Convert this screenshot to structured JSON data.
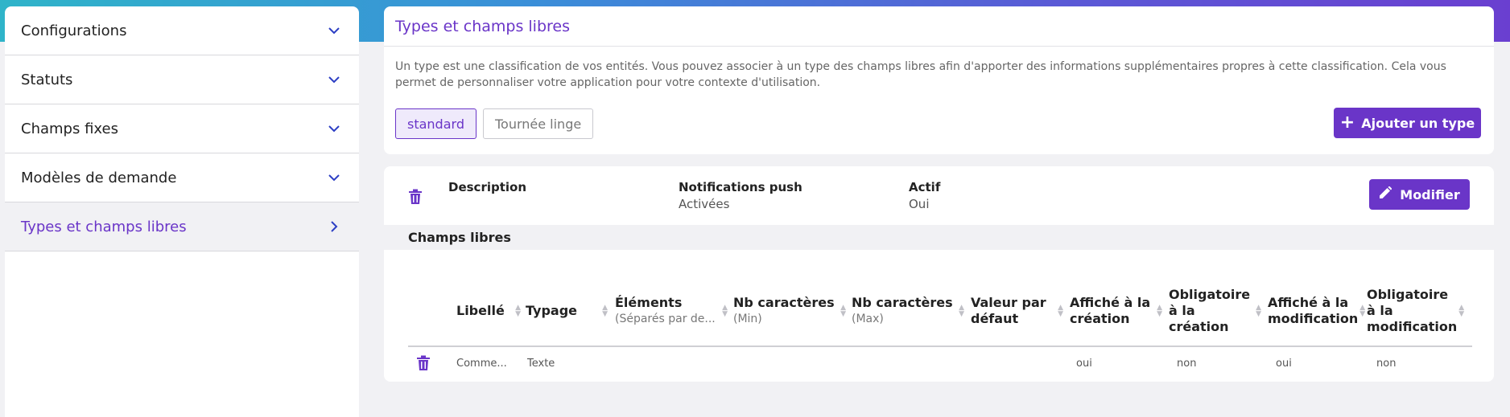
{
  "sidebar": {
    "items": [
      {
        "label": "Configurations",
        "icon": "chevron-down-icon"
      },
      {
        "label": "Statuts",
        "icon": "chevron-down-icon"
      },
      {
        "label": "Champs fixes",
        "icon": "chevron-down-icon"
      },
      {
        "label": "Modèles de demande",
        "icon": "chevron-down-icon"
      },
      {
        "label": "Types et champs libres",
        "icon": "chevron-right-icon",
        "active": true
      }
    ]
  },
  "types_card": {
    "title": "Types et champs libres",
    "description": "Un type est une classification de vos entités. Vous pouvez associer à un type des champs libres afin d'apporter des informations supplémentaires propres à cette classification. Cela vous permet de personnaliser votre application pour votre contexte d'utilisation.",
    "types": [
      "standard",
      "Tournée linge"
    ],
    "selected_type": "standard",
    "add_button": "Ajouter un type"
  },
  "type_detail": {
    "description_label": "Description",
    "notifications_label": "Notifications push",
    "notifications_value": "Activées",
    "active_label": "Actif",
    "active_value": "Oui",
    "modify_button": "Modifier",
    "section_title": "Champs libres"
  },
  "fields_table": {
    "headers": [
      {
        "label": "Libellé",
        "sub": ""
      },
      {
        "label": "Typage",
        "sub": ""
      },
      {
        "label": "Éléments",
        "sub": "(Séparés par de..."
      },
      {
        "label": "Nb caractères",
        "sub": "(Min)"
      },
      {
        "label": "Nb caractères",
        "sub": "(Max)"
      },
      {
        "label": "Valeur par défaut",
        "sub": ""
      },
      {
        "label": "Affiché à la création",
        "sub": ""
      },
      {
        "label": "Obligatoire à la création",
        "sub": ""
      },
      {
        "label": "Affiché à la modification",
        "sub": ""
      },
      {
        "label": "Obligatoire à la modification",
        "sub": ""
      }
    ],
    "rows": [
      [
        "Comme...",
        "Texte",
        "",
        "",
        "",
        "",
        "oui",
        "non",
        "oui",
        "non"
      ]
    ]
  },
  "colors": {
    "accent": "#6a35c8",
    "background": "#f1f1f4"
  }
}
